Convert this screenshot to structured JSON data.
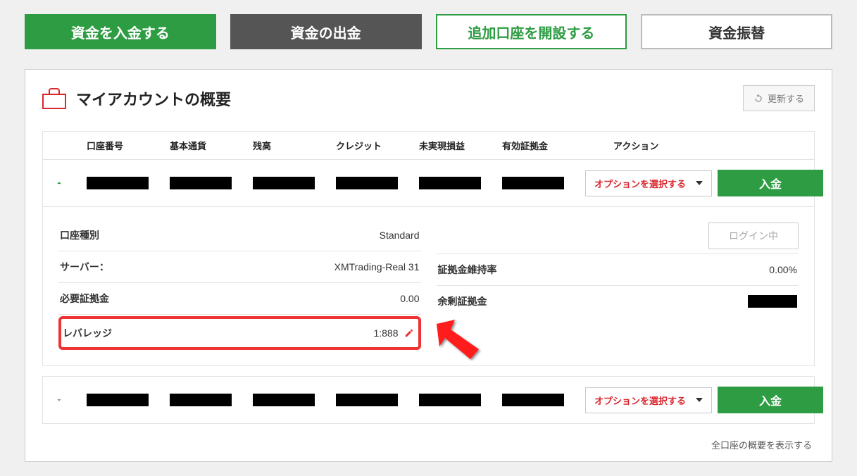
{
  "tabs": {
    "deposit": "資金を入金する",
    "withdraw": "資金の出金",
    "open_account": "追加口座を開設する",
    "transfer": "資金振替"
  },
  "panel": {
    "title": "マイアカウントの概要",
    "refresh": "更新する"
  },
  "headers": {
    "account_no": "口座番号",
    "base_ccy": "基本通貨",
    "balance": "残高",
    "credit": "クレジット",
    "unrealized": "未実現損益",
    "equity": "有効証拠金",
    "action": "アクション"
  },
  "row": {
    "option_select": "オプションを選択する",
    "deposit_btn": "入金"
  },
  "details": {
    "account_type_label": "口座種別",
    "account_type_value": "Standard",
    "server_label": "サーバー：",
    "server_value": "XMTrading-Real 31",
    "req_margin_label": "必要証拠金",
    "req_margin_value": "0.00",
    "leverage_label": "レバレッジ",
    "leverage_value": "1:888",
    "login_status": "ログイン中",
    "margin_level_label": "証拠金維持率",
    "margin_level_value": "0.00%",
    "free_margin_label": "余剰証拠金"
  },
  "footer": {
    "show_all": "全口座の概要を表示する"
  }
}
